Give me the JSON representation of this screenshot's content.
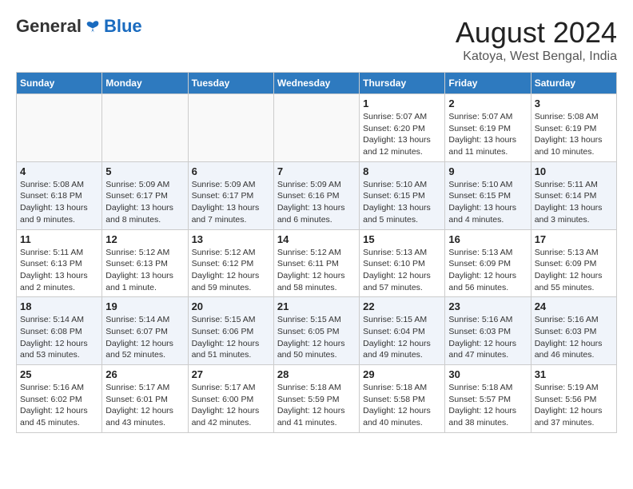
{
  "logo": {
    "general": "General",
    "blue": "Blue"
  },
  "title": {
    "month": "August 2024",
    "location": "Katoya, West Bengal, India"
  },
  "weekdays": [
    "Sunday",
    "Monday",
    "Tuesday",
    "Wednesday",
    "Thursday",
    "Friday",
    "Saturday"
  ],
  "weeks": [
    [
      {
        "day": "",
        "info": ""
      },
      {
        "day": "",
        "info": ""
      },
      {
        "day": "",
        "info": ""
      },
      {
        "day": "",
        "info": ""
      },
      {
        "day": "1",
        "info": "Sunrise: 5:07 AM\nSunset: 6:20 PM\nDaylight: 13 hours\nand 12 minutes."
      },
      {
        "day": "2",
        "info": "Sunrise: 5:07 AM\nSunset: 6:19 PM\nDaylight: 13 hours\nand 11 minutes."
      },
      {
        "day": "3",
        "info": "Sunrise: 5:08 AM\nSunset: 6:19 PM\nDaylight: 13 hours\nand 10 minutes."
      }
    ],
    [
      {
        "day": "4",
        "info": "Sunrise: 5:08 AM\nSunset: 6:18 PM\nDaylight: 13 hours\nand 9 minutes."
      },
      {
        "day": "5",
        "info": "Sunrise: 5:09 AM\nSunset: 6:17 PM\nDaylight: 13 hours\nand 8 minutes."
      },
      {
        "day": "6",
        "info": "Sunrise: 5:09 AM\nSunset: 6:17 PM\nDaylight: 13 hours\nand 7 minutes."
      },
      {
        "day": "7",
        "info": "Sunrise: 5:09 AM\nSunset: 6:16 PM\nDaylight: 13 hours\nand 6 minutes."
      },
      {
        "day": "8",
        "info": "Sunrise: 5:10 AM\nSunset: 6:15 PM\nDaylight: 13 hours\nand 5 minutes."
      },
      {
        "day": "9",
        "info": "Sunrise: 5:10 AM\nSunset: 6:15 PM\nDaylight: 13 hours\nand 4 minutes."
      },
      {
        "day": "10",
        "info": "Sunrise: 5:11 AM\nSunset: 6:14 PM\nDaylight: 13 hours\nand 3 minutes."
      }
    ],
    [
      {
        "day": "11",
        "info": "Sunrise: 5:11 AM\nSunset: 6:13 PM\nDaylight: 13 hours\nand 2 minutes."
      },
      {
        "day": "12",
        "info": "Sunrise: 5:12 AM\nSunset: 6:13 PM\nDaylight: 13 hours\nand 1 minute."
      },
      {
        "day": "13",
        "info": "Sunrise: 5:12 AM\nSunset: 6:12 PM\nDaylight: 12 hours\nand 59 minutes."
      },
      {
        "day": "14",
        "info": "Sunrise: 5:12 AM\nSunset: 6:11 PM\nDaylight: 12 hours\nand 58 minutes."
      },
      {
        "day": "15",
        "info": "Sunrise: 5:13 AM\nSunset: 6:10 PM\nDaylight: 12 hours\nand 57 minutes."
      },
      {
        "day": "16",
        "info": "Sunrise: 5:13 AM\nSunset: 6:09 PM\nDaylight: 12 hours\nand 56 minutes."
      },
      {
        "day": "17",
        "info": "Sunrise: 5:13 AM\nSunset: 6:09 PM\nDaylight: 12 hours\nand 55 minutes."
      }
    ],
    [
      {
        "day": "18",
        "info": "Sunrise: 5:14 AM\nSunset: 6:08 PM\nDaylight: 12 hours\nand 53 minutes."
      },
      {
        "day": "19",
        "info": "Sunrise: 5:14 AM\nSunset: 6:07 PM\nDaylight: 12 hours\nand 52 minutes."
      },
      {
        "day": "20",
        "info": "Sunrise: 5:15 AM\nSunset: 6:06 PM\nDaylight: 12 hours\nand 51 minutes."
      },
      {
        "day": "21",
        "info": "Sunrise: 5:15 AM\nSunset: 6:05 PM\nDaylight: 12 hours\nand 50 minutes."
      },
      {
        "day": "22",
        "info": "Sunrise: 5:15 AM\nSunset: 6:04 PM\nDaylight: 12 hours\nand 49 minutes."
      },
      {
        "day": "23",
        "info": "Sunrise: 5:16 AM\nSunset: 6:03 PM\nDaylight: 12 hours\nand 47 minutes."
      },
      {
        "day": "24",
        "info": "Sunrise: 5:16 AM\nSunset: 6:03 PM\nDaylight: 12 hours\nand 46 minutes."
      }
    ],
    [
      {
        "day": "25",
        "info": "Sunrise: 5:16 AM\nSunset: 6:02 PM\nDaylight: 12 hours\nand 45 minutes."
      },
      {
        "day": "26",
        "info": "Sunrise: 5:17 AM\nSunset: 6:01 PM\nDaylight: 12 hours\nand 43 minutes."
      },
      {
        "day": "27",
        "info": "Sunrise: 5:17 AM\nSunset: 6:00 PM\nDaylight: 12 hours\nand 42 minutes."
      },
      {
        "day": "28",
        "info": "Sunrise: 5:18 AM\nSunset: 5:59 PM\nDaylight: 12 hours\nand 41 minutes."
      },
      {
        "day": "29",
        "info": "Sunrise: 5:18 AM\nSunset: 5:58 PM\nDaylight: 12 hours\nand 40 minutes."
      },
      {
        "day": "30",
        "info": "Sunrise: 5:18 AM\nSunset: 5:57 PM\nDaylight: 12 hours\nand 38 minutes."
      },
      {
        "day": "31",
        "info": "Sunrise: 5:19 AM\nSunset: 5:56 PM\nDaylight: 12 hours\nand 37 minutes."
      }
    ]
  ]
}
